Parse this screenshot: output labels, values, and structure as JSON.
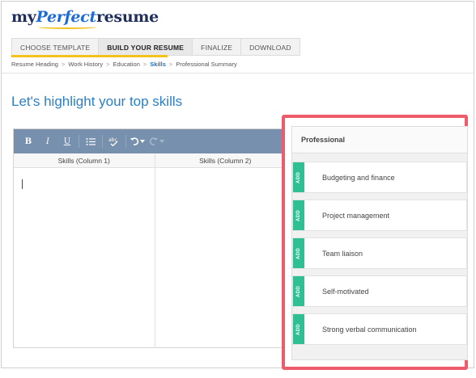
{
  "logo": {
    "part1": "my",
    "part2": "Perfect",
    "part3": "resume"
  },
  "steps": [
    {
      "label": "CHOOSE TEMPLATE",
      "active": false
    },
    {
      "label": "BUILD YOUR RESUME",
      "active": true
    },
    {
      "label": "FINALIZE",
      "active": false
    },
    {
      "label": "DOWNLOAD",
      "active": false
    }
  ],
  "breadcrumb": {
    "items": [
      "Resume Heading",
      "Work History",
      "Education",
      "Skills",
      "Professional Summary"
    ],
    "separator": ">",
    "current": "Skills"
  },
  "page_title": "Let's highlight your top skills",
  "editor": {
    "toolbar": {
      "bold": "B",
      "italic": "I",
      "underline": "U",
      "list_icon": "bullet-list-icon",
      "spellcheck": "abc",
      "undo_icon": "undo-icon",
      "redo_icon": "redo-icon"
    },
    "columns": [
      "Skills (Column 1)",
      "Skills (Column 2)"
    ]
  },
  "suggestions": {
    "title": "Professional",
    "add_label": "ADD",
    "items": [
      "Budgeting and finance",
      "Project management",
      "Team liaison",
      "Self-motivated",
      "Strong verbal communication"
    ]
  },
  "colors": {
    "accent_blue": "#2b7fc6",
    "toolbar": "#7790ad",
    "add_green": "#2fbf92",
    "highlight_red": "#ee5b6a",
    "step_underline": "#f3c21b"
  }
}
